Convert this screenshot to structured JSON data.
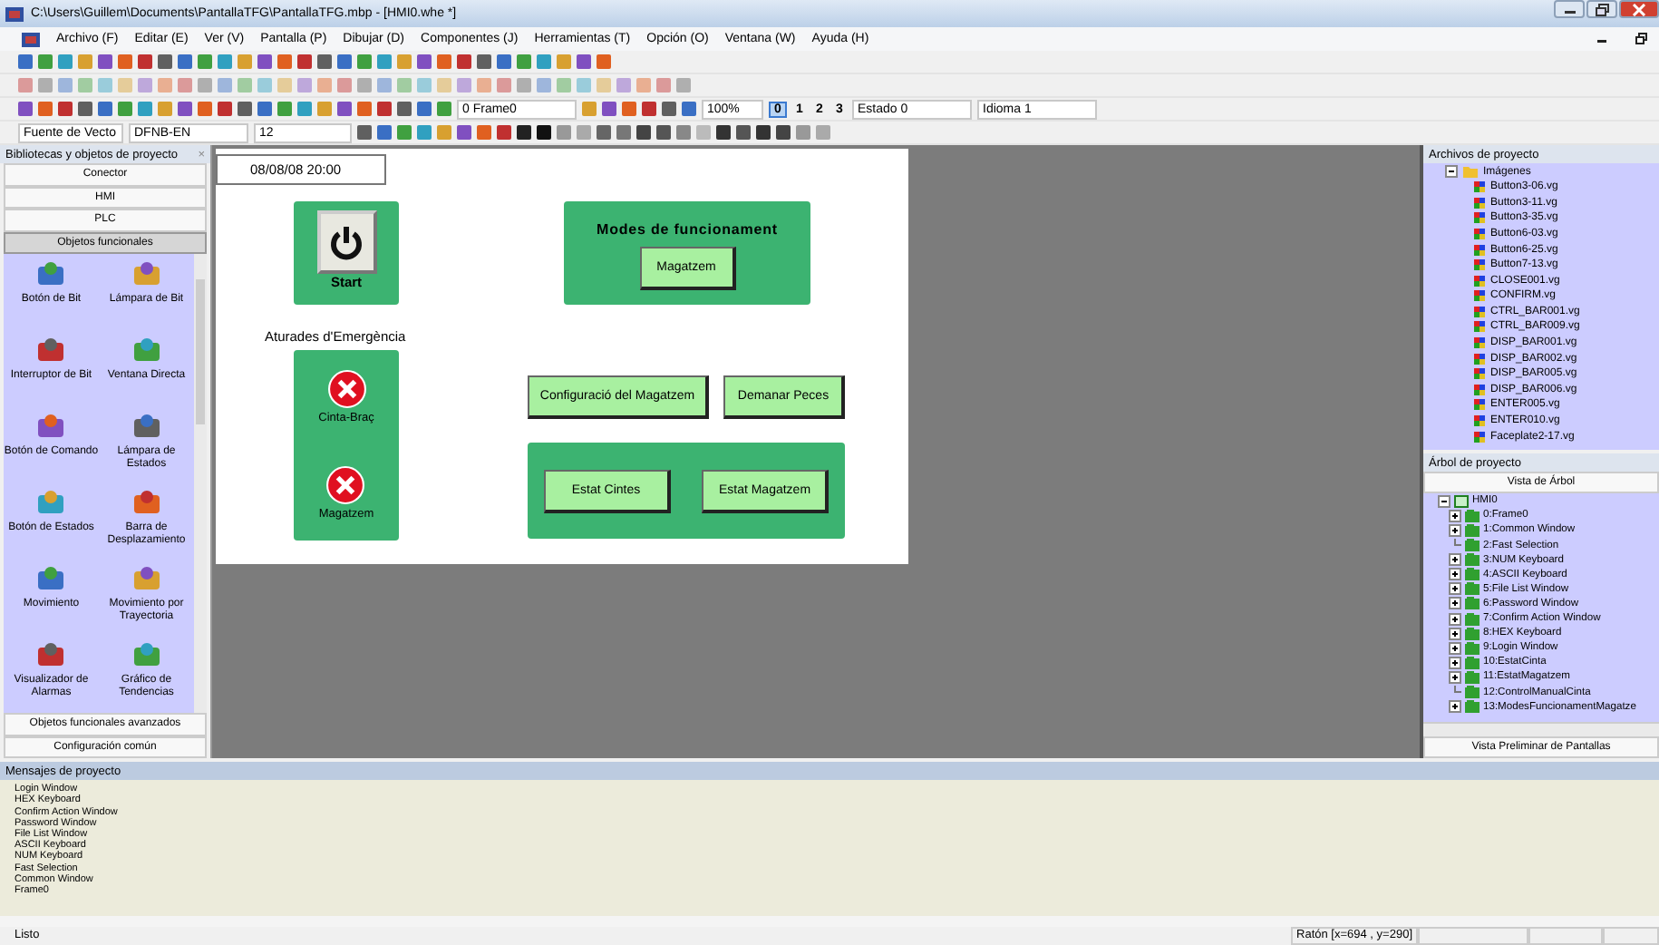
{
  "window": {
    "title": "C:\\Users\\Guillem\\Documents\\PantallaTFG\\PantallaTFG.mbp - [HMI0.whe *]"
  },
  "menu": [
    "Archivo (F)",
    "Editar (E)",
    "Ver (V)",
    "Pantalla (P)",
    "Dibujar (D)",
    "Componentes (J)",
    "Herramientas (T)",
    "Opción (O)",
    "Ventana (W)",
    "Ayuda (H)"
  ],
  "toolbar": {
    "frame_select": "0 Frame0",
    "zoom": "100%",
    "state_buttons": [
      {
        "label": "0",
        "selected": true
      },
      {
        "label": "1",
        "selected": false
      },
      {
        "label": "2",
        "selected": false
      },
      {
        "label": "3",
        "selected": false
      }
    ],
    "state_select": "Estado 0",
    "language_select": "Idioma 1",
    "font_select": "Fuente de Vecto",
    "font_name": "DFNB-EN",
    "font_size": "12"
  },
  "library": {
    "title": "Bibliotecas y objetos de proyecto",
    "close": "×",
    "sections": [
      {
        "label": "Conector",
        "expanded": false
      },
      {
        "label": "HMI",
        "expanded": false
      },
      {
        "label": "PLC",
        "expanded": false
      },
      {
        "label": "Objetos funcionales",
        "expanded": true,
        "items": [
          {
            "label": "Botón de Bit"
          },
          {
            "label": "Lámpara de Bit"
          },
          {
            "label": "Interruptor de Bit"
          },
          {
            "label": "Ventana Directa"
          },
          {
            "label": "Botón de Comando"
          },
          {
            "label": "Lámpara de Estados"
          },
          {
            "label": "Botón de Estados"
          },
          {
            "label": "Barra de Desplazamiento"
          },
          {
            "label": "Movimiento"
          },
          {
            "label": "Movimiento por Trayectoria"
          },
          {
            "label": "Visualizador de Alarmas"
          },
          {
            "label": "Gráfico de Tendencias"
          }
        ]
      },
      {
        "label": "Objetos funcionales avanzados",
        "expanded": false
      },
      {
        "label": "Configuración común",
        "expanded": false
      }
    ]
  },
  "canvas": {
    "datetime": "08/08/08 20:00",
    "start_label": "Start",
    "emergency_title": "Aturades d'Emergència",
    "emergency_stops": [
      {
        "label": "Cinta-Braç"
      },
      {
        "label": "Magatzem"
      }
    ],
    "modes_title": "Modes de funcionament",
    "modes_button": "Magatzem",
    "config_button": "Configuració del Magatzem",
    "request_button": "Demanar Peces",
    "status_buttons": [
      "Estat Cintes",
      "Estat Magatzem"
    ]
  },
  "project_files": {
    "title": "Archivos de proyecto",
    "folder": {
      "label": "Imágenes",
      "expanded": true,
      "files": [
        "Button3-06.vg",
        "Button3-11.vg",
        "Button3-35.vg",
        "Button6-03.vg",
        "Button6-25.vg",
        "Button7-13.vg",
        "CLOSE001.vg",
        "CONFIRM.vg",
        "CTRL_BAR001.vg",
        "CTRL_BAR009.vg",
        "DISP_BAR001.vg",
        "DISP_BAR002.vg",
        "DISP_BAR005.vg",
        "DISP_BAR006.vg",
        "ENTER005.vg",
        "ENTER010.vg",
        "Faceplate2-17.vg"
      ]
    }
  },
  "project_tree": {
    "title": "Árbol de proyecto",
    "tab": "Vista de Árbol",
    "root": {
      "label": "HMI0",
      "expanded": true,
      "children": [
        {
          "label": "0:Frame0",
          "expandable": true
        },
        {
          "label": "1:Common Window",
          "expandable": true
        },
        {
          "label": "2:Fast Selection",
          "expandable": false
        },
        {
          "label": "3:NUM Keyboard",
          "expandable": true
        },
        {
          "label": "4:ASCII Keyboard",
          "expandable": true
        },
        {
          "label": "5:File List Window",
          "expandable": true
        },
        {
          "label": "6:Password Window",
          "expandable": true
        },
        {
          "label": "7:Confirm Action Window",
          "expandable": true
        },
        {
          "label": "8:HEX Keyboard",
          "expandable": true
        },
        {
          "label": "9:Login Window",
          "expandable": true
        },
        {
          "label": "10:EstatCinta",
          "expandable": true
        },
        {
          "label": "11:EstatMagatzem",
          "expandable": true
        },
        {
          "label": "12:ControlManualCinta",
          "expandable": false
        },
        {
          "label": "13:ModesFuncionamentMagatze",
          "expandable": true
        }
      ]
    },
    "footer": "Vista Preliminar de Pantallas"
  },
  "messages": {
    "title": "Mensajes de proyecto",
    "lines": [
      "Login Window",
      "HEX Keyboard",
      "Confirm Action Window",
      "Password Window",
      "File List Window",
      "ASCII Keyboard",
      "NUM Keyboard",
      "Fast Selection",
      "Common Window",
      "Frame0"
    ]
  },
  "status_bar": {
    "text": "Listo",
    "mouse": "Ratón [x=694 , y=290]"
  }
}
